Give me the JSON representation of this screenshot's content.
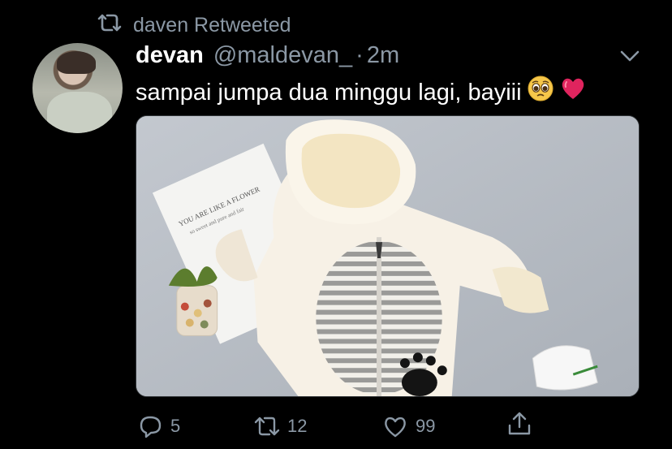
{
  "retweet": {
    "label": "daven Retweeted",
    "icon": "retweet-icon"
  },
  "tweet": {
    "name": "devan",
    "handle": "@maldevan_",
    "separator": "·",
    "time": "2m",
    "text": "sampai jumpa dua minggu lagi, bayiii",
    "emojis": [
      "pleading-face-emoji",
      "red-heart-emoji"
    ]
  },
  "actions": {
    "reply_count": "5",
    "retweet_count": "12",
    "like_count": "99",
    "share_icon": "share-icon"
  },
  "media": {
    "card_text_line1": "YOU ARE LIKE A FLOWER",
    "card_text_line2": "so sweet and pure and fair"
  },
  "colors": {
    "background": "#000000",
    "text_primary": "#ffffff",
    "text_secondary": "#8b98a5",
    "heart": "#e0245e"
  }
}
